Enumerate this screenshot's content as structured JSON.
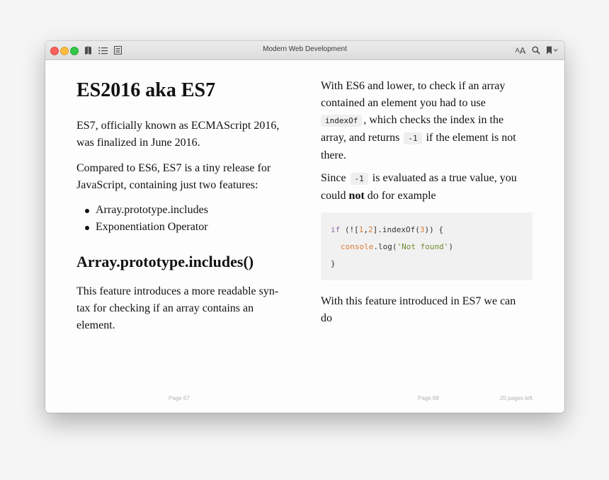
{
  "window": {
    "title": "Modern Web Development"
  },
  "toolbar": {
    "left_icons": [
      "book-icon",
      "list-icon",
      "notes-icon"
    ],
    "right_icons": [
      "font-size-icon",
      "search-icon",
      "bookmark-icon"
    ],
    "font_small": "A",
    "font_big": "A"
  },
  "left_page": {
    "heading": "ES2016 aka ES7",
    "para1_line1": "ES7, officially known as ECMAScript 2016,",
    "para1_line2": "was finalized in June 2016.",
    "para2_line1": "Compared to ES6, ES7 is a tiny release for",
    "para2_line2": "JavaScript, containing just two features:",
    "bullets": [
      "Array.prototype.includes",
      "Exponentiation Operator"
    ],
    "subheading": "Array.prototype.includes()",
    "para3_line1": "This feature introduces a more readable syn-",
    "para3_line2": "tax for checking if an array contains an",
    "para3_line3": "element.",
    "page_label": "Page 67"
  },
  "right_page": {
    "p1_l1": "With ES6 and lower, to check if an array",
    "p1_l2": "contained an element you had to use",
    "p1_code1": "indexOf",
    "p1_l3_after": ", which checks the index in the",
    "p1_l4_before": "array, and returns",
    "p1_code2": "-1",
    "p1_l4_after": "if the element is not",
    "p1_l5": "there.",
    "p2_before": "Since",
    "p2_code": "-1",
    "p2_after": "is evaluated as a true value, you",
    "p2_l2_before": "could",
    "p2_bold": "not",
    "p2_l2_after": "do for example",
    "code": {
      "l1_kw": "if",
      "l1_a": " (![",
      "l1_n1": "1",
      "l1_b": ",",
      "l1_n2": "2",
      "l1_c": "].indexOf(",
      "l1_n3": "3",
      "l1_d": ")) {",
      "l2_obj": "console",
      "l2_a": ".log(",
      "l2_str": "'Not found'",
      "l2_b": ")",
      "l3": "}"
    },
    "p3_l1": "With this feature introduced in ES7 we can",
    "p3_l2": "do",
    "page_label": "Page 68",
    "pages_left": "20 pages left"
  }
}
